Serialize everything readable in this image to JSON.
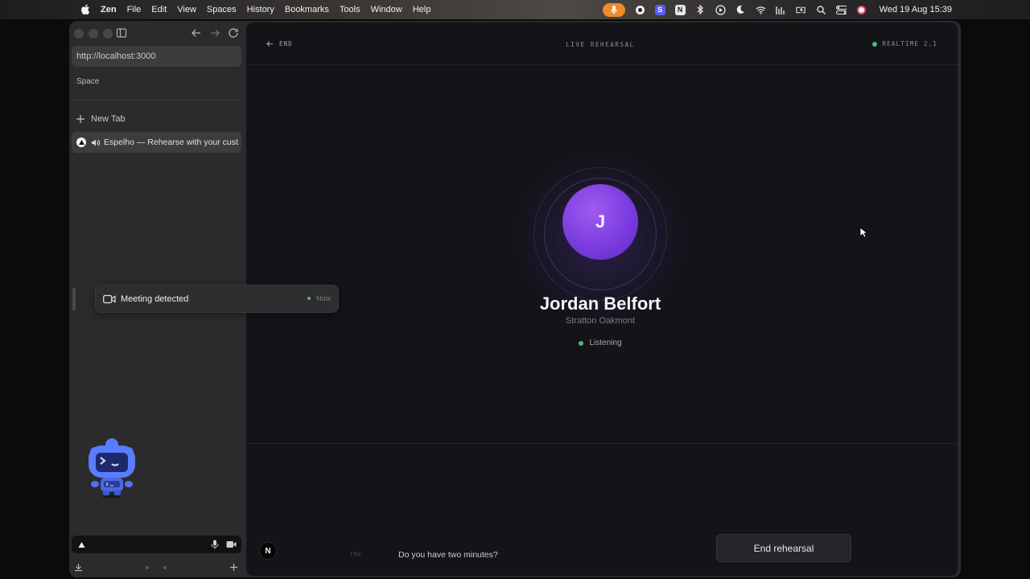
{
  "menubar": {
    "app_name": "Zen",
    "menus": [
      "File",
      "Edit",
      "View",
      "Spaces",
      "History",
      "Bookmarks",
      "Tools",
      "Window",
      "Help"
    ],
    "clock": "Wed 19 Aug  15:39",
    "status_icons": [
      "mic-icon",
      "record-icon",
      "stack-icon",
      "notion-icon",
      "bluetooth-icon",
      "play-icon",
      "moon-icon",
      "wifi-icon",
      "bar-chart-icon",
      "battery-icon",
      "search-icon",
      "control-center-icon",
      "siri-icon"
    ],
    "accent_mic": "#f08a2a"
  },
  "browser": {
    "url": "http://localhost:3000",
    "space_label": "Space",
    "new_tab_label": "New Tab",
    "active_tab_title": "Espelho — Rehearse with your cust"
  },
  "notification": {
    "title": "Meeting detected",
    "time": "Now",
    "status_color": "#3ec47e"
  },
  "rehearsal": {
    "end_label": "END",
    "header_title": "LIVE REHEARSAL",
    "model_label": "REALTIME 2.1",
    "avatar_initial": "J",
    "person_name": "Jordan Belfort",
    "company": "Stratton Oakmont",
    "status": "Listening",
    "status_color": "#4cb97c",
    "avatar_color": "#7b3ce0",
    "speaker_label": "YOU",
    "transcript": "Do you have two minutes?",
    "end_button_label": "End rehearsal",
    "badge_letter": "N"
  }
}
